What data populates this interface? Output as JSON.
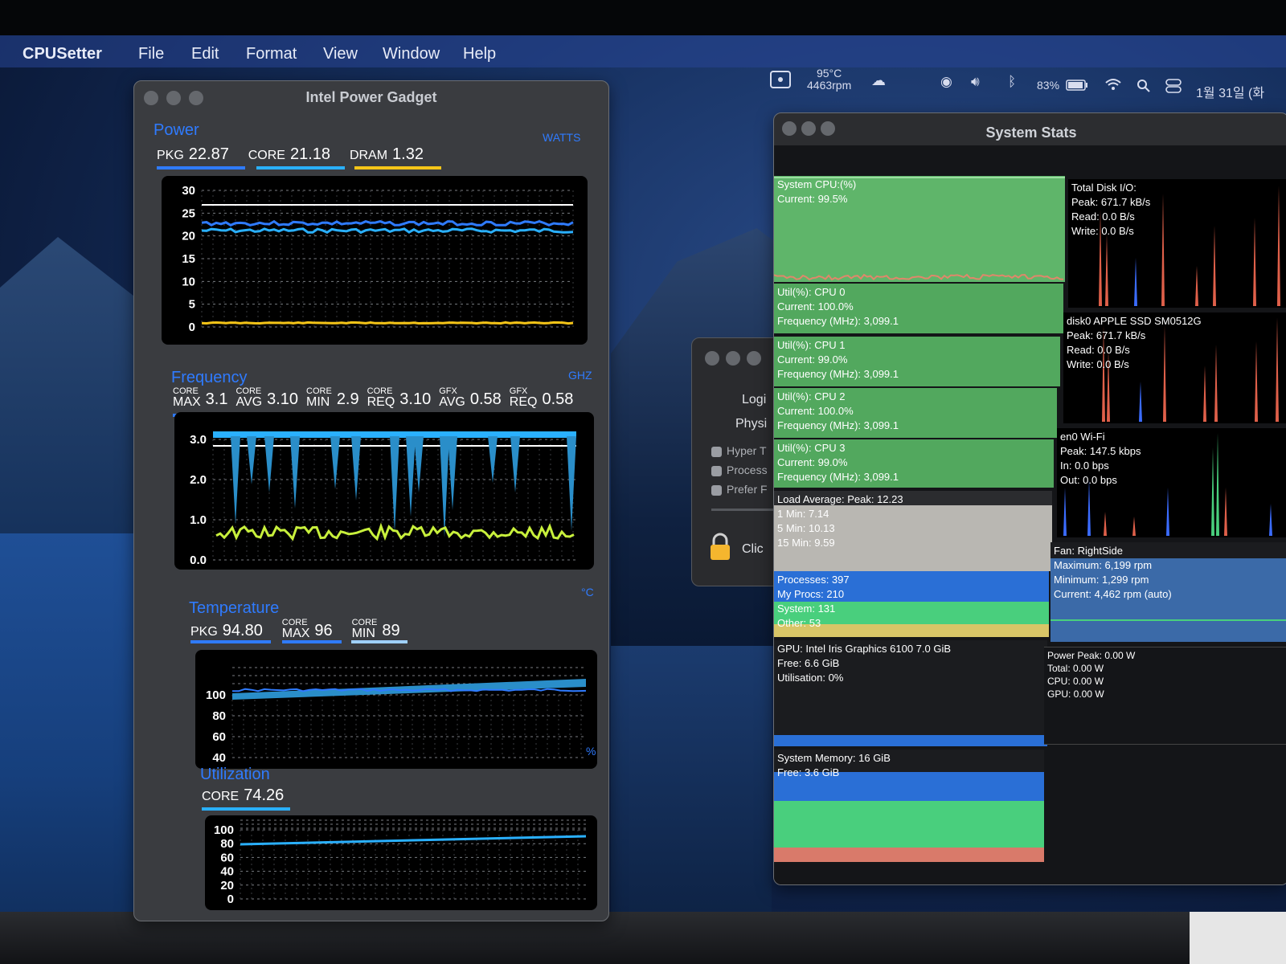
{
  "menubar": {
    "app": "CPUSetter",
    "items": [
      "File",
      "Edit",
      "Format",
      "View",
      "Window",
      "Help"
    ],
    "temp": "95°C",
    "rpm": "4463rpm",
    "battery": "83%",
    "date": "1월 31일 (화"
  },
  "ipg": {
    "title": "Intel Power Gadget",
    "power": {
      "title": "Power",
      "unit": "WATTS",
      "pkg_label": "PKG",
      "pkg": "22.87",
      "core_label": "CORE",
      "core": "21.18",
      "dram_label": "DRAM",
      "dram": "1.32",
      "yticks": [
        "30",
        "25",
        "20",
        "15",
        "10",
        "5",
        "0"
      ],
      "colors": {
        "pkg": "#2f7bff",
        "core": "#2ab0ff",
        "dram": "#f5c518",
        "limit": "#ffffff"
      }
    },
    "frequency": {
      "title": "Frequency",
      "unit": "GHZ",
      "items": [
        {
          "top": "CORE",
          "bot": "MAX",
          "val": "3.1",
          "color": "#2f7bff"
        },
        {
          "top": "CORE",
          "bot": "AVG",
          "val": "3.10",
          "color": "#2ab0ff"
        },
        {
          "top": "CORE",
          "bot": "MIN",
          "val": "2.9",
          "color": "#9fd0ff"
        },
        {
          "top": "CORE",
          "bot": "REQ",
          "val": "3.10",
          "color": "#ff6fb0"
        },
        {
          "top": "GFX",
          "bot": "AVG",
          "val": "0.58",
          "color": "#c8f03c"
        },
        {
          "top": "GFX",
          "bot": "REQ",
          "val": "0.58",
          "color": "#ff7a3c"
        }
      ],
      "yticks": [
        "3.0",
        "2.0",
        "1.0",
        "0.0"
      ]
    },
    "temperature": {
      "title": "Temperature",
      "unit": "°C",
      "pkg_label": "PKG",
      "pkg": "94.80",
      "max_top": "CORE",
      "max_bot": "MAX",
      "max": "96",
      "min_top": "CORE",
      "min_bot": "MIN",
      "min": "89",
      "yticks": [
        "100",
        "80",
        "60",
        "40"
      ]
    },
    "utilization": {
      "title": "Utilization",
      "unit": "%",
      "core_label": "CORE",
      "core": "74.26",
      "yticks": [
        "100",
        "80",
        "60",
        "40",
        "20",
        "0"
      ]
    }
  },
  "dialog": {
    "line1": "Logi",
    "line2": "Physi",
    "check1": "Hyper T",
    "check2": "Process",
    "check3": "Prefer F",
    "footer": "Clic"
  },
  "sysstats": {
    "title": "System Stats",
    "cpu": {
      "l1": "System CPU:(%)",
      "l2": "Current: 99.5%"
    },
    "cpu0": {
      "l1": "Util(%): CPU 0",
      "l2": "Current: 100.0%",
      "l3": "Frequency (MHz): 3,099.1"
    },
    "cpu1": {
      "l1": "Util(%): CPU 1",
      "l2": "Current: 99.0%",
      "l3": "Frequency (MHz): 3,099.1"
    },
    "cpu2": {
      "l1": "Util(%): CPU 2",
      "l2": "Current: 100.0%",
      "l3": "Frequency (MHz): 3,099.1"
    },
    "cpu3": {
      "l1": "Util(%): CPU 3",
      "l2": "Current: 99.0%",
      "l3": "Frequency (MHz): 3,099.1"
    },
    "load": {
      "l1": "Load Average: Peak: 12.23",
      "l2": "1 Min: 7.14",
      "l3": "5 Min: 10.13",
      "l4": "15 Min: 9.59"
    },
    "procs": {
      "l1": "Processes: 397",
      "l2": "My Procs: 210",
      "l3": "System: 131",
      "l4": "Other: 53"
    },
    "gpu": {
      "l1": "GPU: Intel Iris Graphics 6100 7.0 GiB",
      "l2": "Free: 6.6 GiB",
      "l3": "Utilisation: 0%"
    },
    "mem": {
      "l1": "System Memory: 16 GiB",
      "l2": "Free: 3.6 GiB"
    },
    "disk": {
      "l1": "Total Disk I/O:",
      "l2": "Peak: 671.7 kB/s",
      "l3": "Read: 0.0 B/s",
      "l4": "Write: 0.0 B/s"
    },
    "disk0": {
      "l1": "disk0 APPLE SSD SM0512G",
      "l2": "Peak: 671.7 kB/s",
      "l3": "Read: 0.0 B/s",
      "l4": "Write: 0.0 B/s"
    },
    "net": {
      "l1": "en0 Wi-Fi",
      "l2": "Peak: 147.5 kbps",
      "l3": "In: 0.0 bps",
      "l4": "Out: 0.0 bps"
    },
    "fan": {
      "l1": "Fan: RightSide",
      "l2": "Maximum: 6,199 rpm",
      "l3": "Minimum: 1,299 rpm",
      "l4": "Current: 4,462 rpm (auto)"
    },
    "power": {
      "l1": "Power Peak: 0.00 W",
      "l2": "Total: 0.00 W",
      "l3": "CPU: 0.00 W",
      "l4": "GPU: 0.00 W"
    }
  }
}
